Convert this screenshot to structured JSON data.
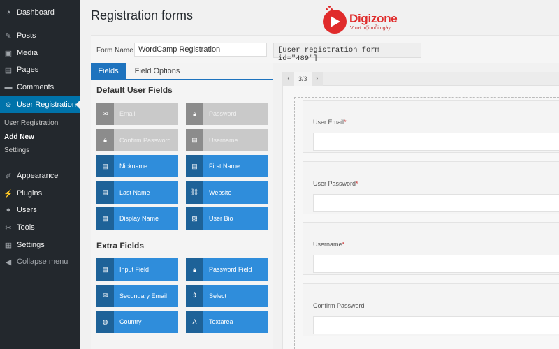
{
  "sidebar": {
    "items": [
      {
        "label": "Dashboard",
        "icon": "dashboard-icon",
        "glyph": "◔"
      },
      {
        "label": "Posts",
        "icon": "pin-icon",
        "glyph": "✎"
      },
      {
        "label": "Media",
        "icon": "media-icon",
        "glyph": "▣"
      },
      {
        "label": "Pages",
        "icon": "pages-icon",
        "glyph": "▤"
      },
      {
        "label": "Comments",
        "icon": "comment-icon",
        "glyph": "▬"
      },
      {
        "label": "User Registration",
        "icon": "accessibility-icon",
        "glyph": "☺"
      },
      {
        "label": "Appearance",
        "icon": "brush-icon",
        "glyph": "✐"
      },
      {
        "label": "Plugins",
        "icon": "plugin-icon",
        "glyph": "⚡"
      },
      {
        "label": "Users",
        "icon": "user-icon",
        "glyph": "●"
      },
      {
        "label": "Tools",
        "icon": "wrench-icon",
        "glyph": "✂"
      },
      {
        "label": "Settings",
        "icon": "settings-icon",
        "glyph": "▦"
      },
      {
        "label": "Collapse menu",
        "icon": "collapse-icon",
        "glyph": "◀"
      }
    ],
    "submenu": [
      "User Registration",
      "Add New",
      "Settings"
    ]
  },
  "page": {
    "title": "Registration forms",
    "logo": {
      "name": "Digizone",
      "tagline": "Vượt trội mỗi ngày",
      "color": "#e02b2b"
    }
  },
  "formbar": {
    "label": "Form Name",
    "value": "WordCamp Registration",
    "shortcode": "[user_registration_form id=\"489\"]"
  },
  "tabs": [
    "Fields",
    "Field Options"
  ],
  "sections": {
    "default": "Default User Fields",
    "extra": "Extra Fields"
  },
  "default_fields": [
    {
      "label": "Email",
      "glyph": "✉",
      "icon": "envelope-icon",
      "disabled": true
    },
    {
      "label": "Password",
      "glyph": "🔒︎",
      "icon": "lock-icon",
      "disabled": true
    },
    {
      "label": "Confirm Password",
      "glyph": "🔒︎",
      "icon": "lock-icon",
      "disabled": true
    },
    {
      "label": "Username",
      "glyph": "▤",
      "icon": "id-card-icon",
      "disabled": true
    },
    {
      "label": "Nickname",
      "glyph": "▤",
      "icon": "id-card-icon",
      "disabled": false
    },
    {
      "label": "First Name",
      "glyph": "▤",
      "icon": "id-card-icon",
      "disabled": false
    },
    {
      "label": "Last Name",
      "glyph": "▤",
      "icon": "id-card-icon",
      "disabled": false
    },
    {
      "label": "Website",
      "glyph": "⛓",
      "icon": "link-icon",
      "disabled": false
    },
    {
      "label": "Display Name",
      "glyph": "▤",
      "icon": "id-card-icon",
      "disabled": false
    },
    {
      "label": "User Bio",
      "glyph": "▧",
      "icon": "bio-icon",
      "disabled": false
    }
  ],
  "extra_fields": [
    {
      "label": "Input Field",
      "glyph": "▤",
      "icon": "input-field-icon"
    },
    {
      "label": "Password Field",
      "glyph": "🔒︎",
      "icon": "lock-icon"
    },
    {
      "label": "Secondary Email",
      "glyph": "✉",
      "icon": "envelope-icon"
    },
    {
      "label": "Select",
      "glyph": "⇕",
      "icon": "select-icon"
    },
    {
      "label": "Country",
      "glyph": "◍",
      "icon": "globe-icon"
    },
    {
      "label": "Textarea",
      "glyph": "A",
      "icon": "textarea-icon"
    }
  ],
  "builder": {
    "pager": {
      "prev": "‹",
      "page": "3/3",
      "next": "›"
    },
    "fields": [
      {
        "label": "User Email",
        "required": "*"
      },
      {
        "label": "User Password",
        "required": "*"
      },
      {
        "label": "Username",
        "required": "*"
      },
      {
        "label": "Confirm Password",
        "required": ""
      }
    ]
  }
}
